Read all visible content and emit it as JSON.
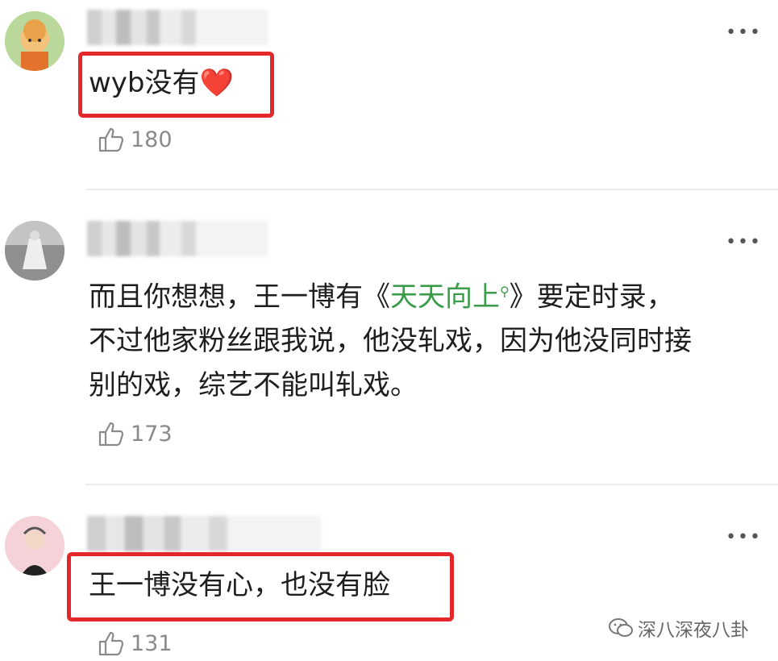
{
  "comments": [
    {
      "text": "wyb没有",
      "emoji": "❤️",
      "likes": "180",
      "more": "•••"
    },
    {
      "text_before": "而且你想想，王一博有《",
      "link": "天天向上",
      "text_after": "》要定时录，",
      "line2": "不过他家粉丝跟我说，他没轧戏，因为他没同时接",
      "line3": "别的戏，综艺不能叫轧戏。",
      "likes": "173",
      "more": "•••"
    },
    {
      "text": "王一博没有心，也没有脸",
      "likes": "131",
      "more": "•••"
    }
  ],
  "watermark": {
    "text": "深八深夜八卦",
    "icon": "wechat-icon"
  },
  "colors": {
    "highlight": "#e3272a",
    "link": "#3a9b4a"
  }
}
